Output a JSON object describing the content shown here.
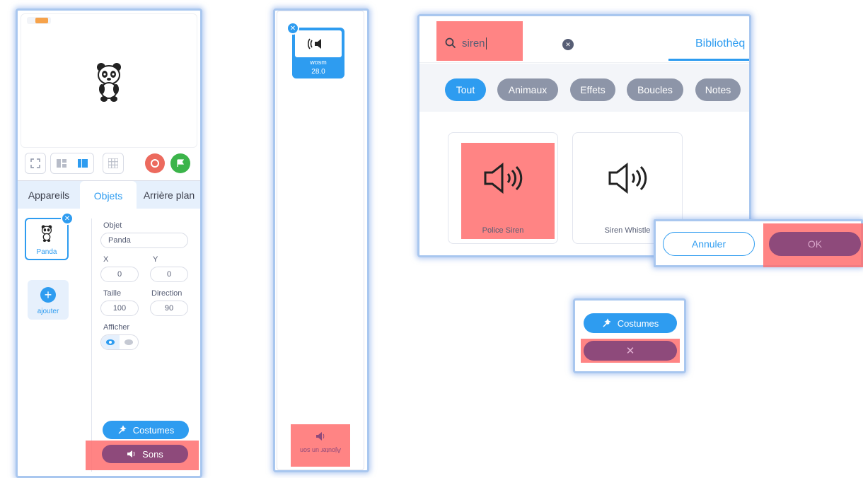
{
  "stage_panel": {
    "tabs": [
      {
        "label": "Appareils"
      },
      {
        "label": "Objets"
      },
      {
        "label": "Arrière plan"
      }
    ],
    "sprite": {
      "name": "Panda"
    },
    "add_sprite_label": "ajouter",
    "props": {
      "objet_label": "Objet",
      "objet_value": "Panda",
      "x_label": "X",
      "x_value": "0",
      "y_label": "Y",
      "y_value": "0",
      "taille_label": "Taille",
      "taille_value": "100",
      "direction_label": "Direction",
      "direction_value": "90",
      "afficher_label": "Afficher"
    },
    "costumes_label": "Costumes",
    "sons_label": "Sons"
  },
  "sound_list": {
    "item": {
      "name": "wosm",
      "duration": "28.0"
    },
    "add_sound_label": "Ajouter un son"
  },
  "library": {
    "search": {
      "value": "siren"
    },
    "tab_label": "Bibliothèq",
    "tags": [
      {
        "label": "Tout"
      },
      {
        "label": "Animaux"
      },
      {
        "label": "Effets"
      },
      {
        "label": "Boucles"
      },
      {
        "label": "Notes"
      }
    ],
    "sounds": [
      {
        "name": "Police Siren"
      },
      {
        "name": "Siren Whistle"
      }
    ],
    "cancel_label": "Annuler",
    "ok_label": "OK"
  },
  "mini_panel": {
    "costumes_label": "Costumes",
    "close_label": "✕"
  },
  "colors": {
    "accent_blue": "#2e9cf0",
    "highlight_red": "#ff6e6e",
    "sons_purple": "#8e4a7b",
    "stop_red": "#ec6a5e",
    "go_green": "#3bb44a"
  }
}
